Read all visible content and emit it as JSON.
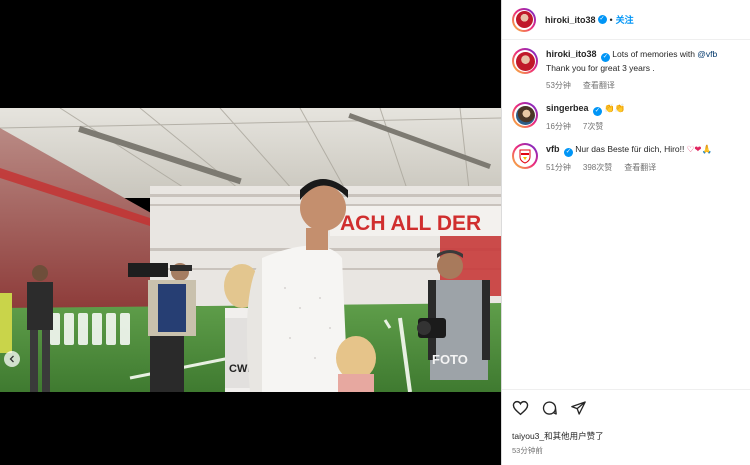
{
  "post": {
    "author": "hiroki_ito38",
    "follow_label": "关注",
    "dot": "•"
  },
  "photo": {
    "banner_text": "ACH ALL DER",
    "camera_bib": "FOTO",
    "vest_text": "CWB"
  },
  "caption": {
    "username": "hiroki_ito38",
    "text_before": "Lots of memories with ",
    "mention": "@vfb",
    "text_line2": "Thank you for great 3 years .",
    "time": "53分钟",
    "translate": "查看翻译"
  },
  "comments": [
    {
      "username": "singerbea",
      "text": "👏👏",
      "time": "16分钟",
      "likes": "7次赞"
    },
    {
      "username": "vfb",
      "text": "Nur das Beste für dich, Hiro!!",
      "emojis": "♡❤🙏",
      "time": "51分钟",
      "likes": "398次赞",
      "translate": "查看翻译"
    }
  ],
  "footer": {
    "likes_text": "taiyou3_和其他用户赞了",
    "time": "53分钟前"
  },
  "icons": [
    "heart-icon",
    "comment-icon",
    "share-icon",
    "verified-icon",
    "chevron-left-icon"
  ],
  "colors": {
    "accent": "#0095f6",
    "verified": "#0095f6",
    "vfb_red": "#e30613"
  }
}
